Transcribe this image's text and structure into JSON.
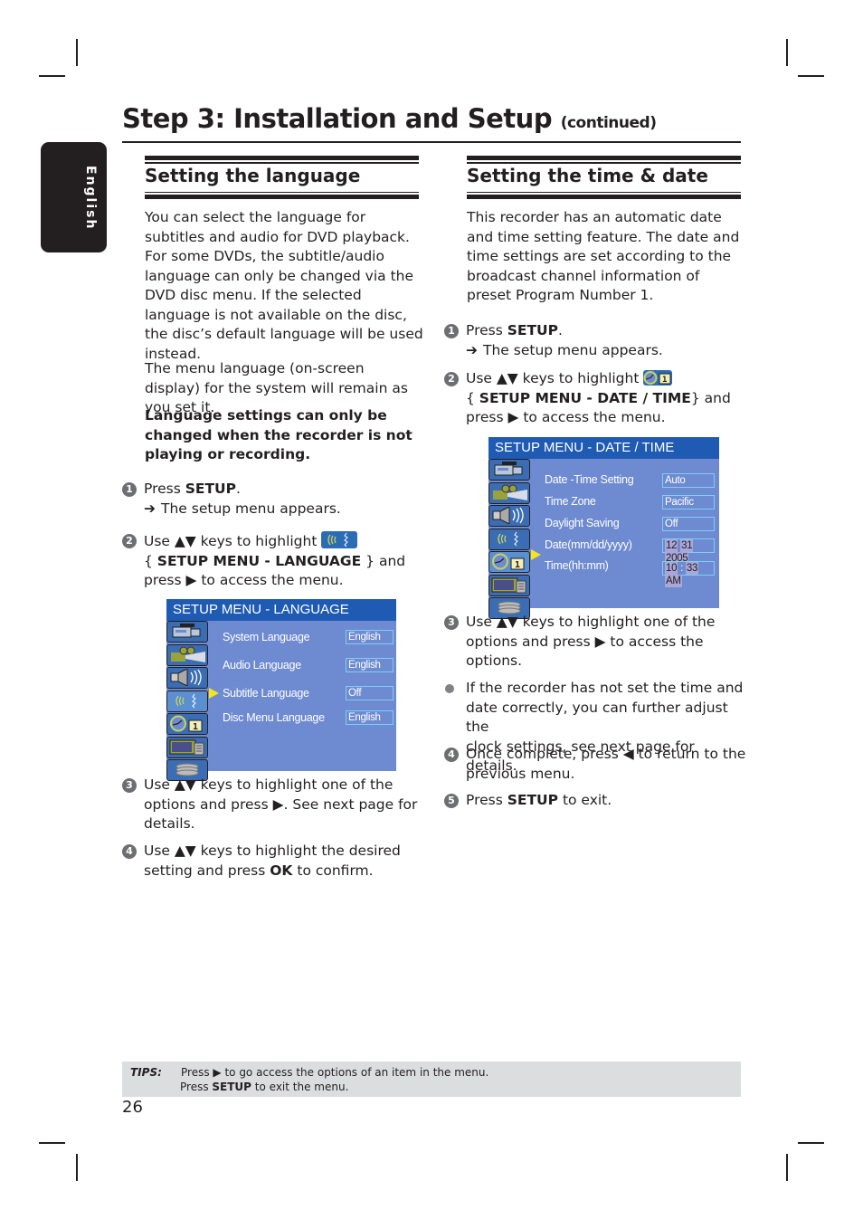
{
  "page": {
    "title": "Step 3: Installation and Setup",
    "title_suffix": "(continued)",
    "side_tab": "English",
    "page_number": "26"
  },
  "left": {
    "heading": "Setting the language",
    "intro": "You can select the language for subtitles and audio for DVD playback. For some DVDs, the subtitle/audio language can only be changed via the DVD disc menu. If the selected language is not available on the disc, the disc’s default language will be used instead.",
    "intro2": "The menu language (on-screen display) for the system will remain as you set it.",
    "warning": "Language settings can only be changed when the recorder is not playing or recording.",
    "steps": [
      {
        "num": "1",
        "pre": "Press ",
        "bold": "SETUP",
        "post": ".",
        "result": "The setup menu appears."
      },
      {
        "num": "2",
        "pre": "Use ▲▼ keys to highlight",
        "bold": "SETUP MENU - LANGUAGE",
        "line2_pre": "{ ",
        "line2_post": " } and",
        "line3": "press ▶ to access the menu."
      },
      {
        "num": "3",
        "text1": "Use ▲▼ keys to highlight one of the",
        "text2": "options and press ▶. See next page for",
        "text3": "details."
      },
      {
        "num": "4",
        "text1": "Use ▲▼ keys to highlight the desired",
        "text2_pre": "setting and press ",
        "bold": "OK",
        "text2_post": " to confirm."
      }
    ],
    "menu": {
      "header": "SETUP MENU - LANGUAGE",
      "icons": [
        "camcorder-icon",
        "projector-icon",
        "speaker-icon",
        "language-icon",
        "clock-calendar-icon",
        "tv-remote-icon",
        "disc-icon"
      ],
      "selected_icon": 3,
      "rows": [
        {
          "label": "System Language",
          "value": "English"
        },
        {
          "label": "Audio Language",
          "value": "English"
        },
        {
          "label": "Subtitle Language",
          "value": "Off"
        },
        {
          "label": "Disc Menu Language",
          "value": "English"
        }
      ],
      "pointer_row": 2
    }
  },
  "right": {
    "heading": "Setting the time & date",
    "intro": "This recorder has an automatic date and time setting feature. The date and time settings are set according to the broadcast channel information of preset Program Number 1.",
    "steps": [
      {
        "num": "1",
        "pre": "Press ",
        "bold": "SETUP",
        "post": ".",
        "result": "The setup menu appears."
      },
      {
        "num": "2",
        "pre": "Use ▲▼ keys to highlight",
        "bold": "SETUP MENU - DATE / TIME",
        "line2_pre": "{ ",
        "line2_post": "} and",
        "line3": "press ▶ to access the menu."
      },
      {
        "num": "3",
        "text1": "Use ▲▼ keys to highlight one of the",
        "text2": "options and press ▶ to access the",
        "text3": "options."
      },
      {
        "bullet": true,
        "text1": "If the recorder has not set the time and",
        "text2": "date correctly, you can further adjust the",
        "text3": "clock settings, see next page for details."
      },
      {
        "num": "4",
        "text1": "Once complete, press ◀ to return to the",
        "text2": "previous menu."
      },
      {
        "num": "5",
        "pre": "Press ",
        "bold": "SETUP",
        "post": " to exit."
      }
    ],
    "menu": {
      "header": "SETUP MENU - DATE / TIME",
      "icons": [
        "camcorder-icon",
        "projector-icon",
        "speaker-icon",
        "language-icon",
        "clock-calendar-icon",
        "tv-remote-icon",
        "disc-icon"
      ],
      "selected_icon": 4,
      "rows": [
        {
          "label": "Date -Time Setting",
          "value": "Auto"
        },
        {
          "label": "Time Zone",
          "value": "Pacific"
        },
        {
          "label": "Daylight Saving",
          "value": "Off"
        },
        {
          "label": "Date(mm/dd/yyyy)",
          "segments": [
            "12",
            "31",
            "2005"
          ]
        },
        {
          "label": "Time(hh:mm)",
          "segments": [
            "10",
            ":",
            "33",
            "AM"
          ]
        }
      ],
      "pointer_row": 3
    }
  },
  "tips": {
    "label": "TIPS:",
    "line1_pre": "Press ",
    "line1_post": " to go access the options of an item in the menu.",
    "line2_pre": "Press ",
    "line2_bold": "SETUP",
    "line2_post": " to exit the menu."
  },
  "colors": {
    "menu_header": "#1f5bb3",
    "menu_body": "#6e8ad0",
    "value_border": "#7cd0f5",
    "pointer": "#f7e21b",
    "tips_bg": "#dcddde"
  }
}
